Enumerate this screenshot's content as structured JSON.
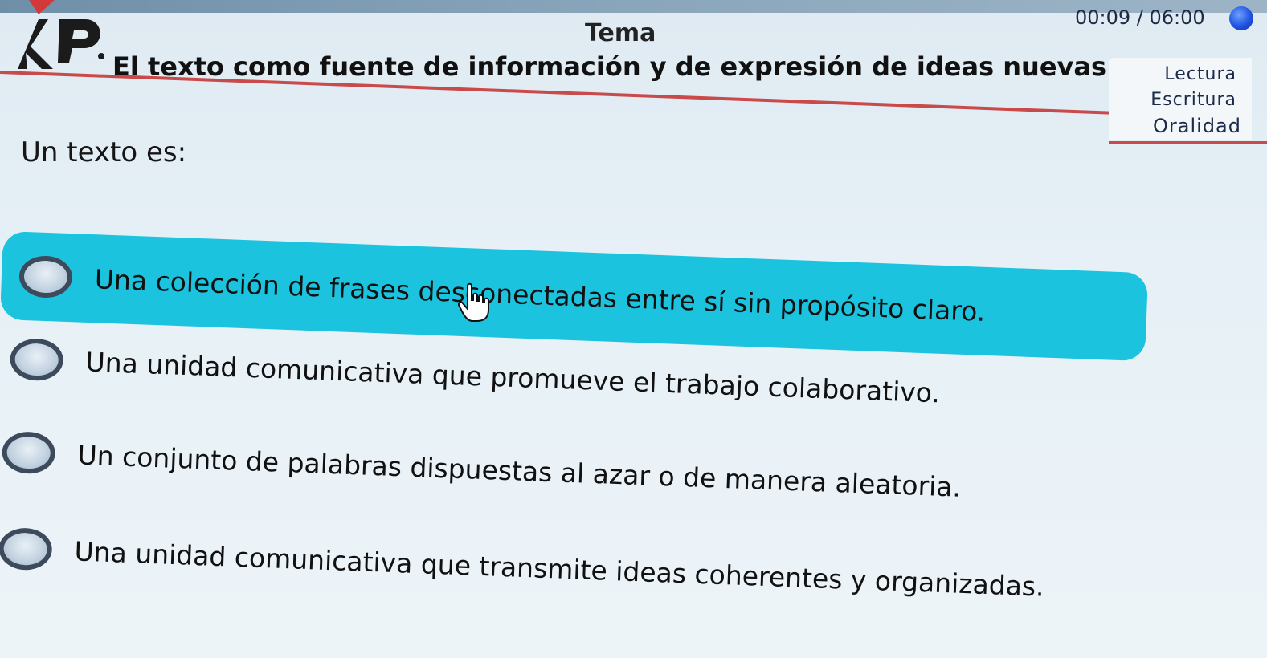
{
  "header": {
    "tema_label": "Tema",
    "topic_title": "El texto como fuente de información y de expresión de ideas nuevas.",
    "timer": "00:09 / 06:00"
  },
  "categories": [
    "Lectura",
    "Escritura",
    "Oralidad"
  ],
  "question": "Un texto es:",
  "options": [
    {
      "text": "Una colección de frases desconectadas entre sí sin propósito claro.",
      "selected": true
    },
    {
      "text": "Una unidad comunicativa que promueve el trabajo colaborativo.",
      "selected": false
    },
    {
      "text": "Un conjunto de palabras dispuestas al azar o de manera aleatoria.",
      "selected": false
    },
    {
      "text": "Una unidad comunicativa que transmite ideas coherentes y organizadas.",
      "selected": false
    }
  ],
  "colors": {
    "selected_highlight": "#1cc3df",
    "accent_rule": "#c94a4a",
    "timer_icon": "#1e52e0"
  },
  "icons": {
    "logo": "kp-logo",
    "timer": "timer-icon",
    "cursor": "hand-pointer-icon"
  }
}
